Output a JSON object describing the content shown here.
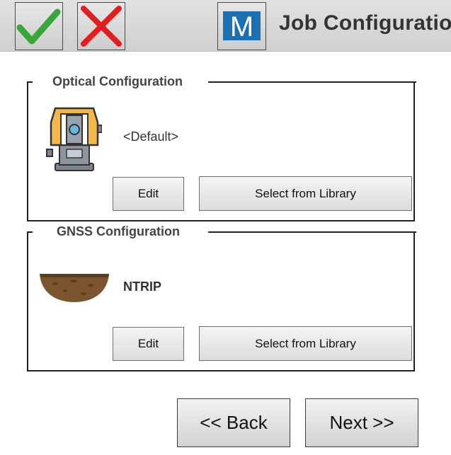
{
  "header": {
    "title": "Job Configuration",
    "ok_icon": "checkmark-icon",
    "cancel_icon": "close-icon",
    "logo_letter": "M",
    "colors": {
      "ok": "#3aa63a",
      "cancel": "#e02020",
      "logo": "#1c6fb0"
    }
  },
  "optical": {
    "title": "Optical Configuration",
    "value": "<Default>",
    "icon": "total-station-icon",
    "edit_label": "Edit",
    "library_label": "Select from Library"
  },
  "gnss": {
    "title": "GNSS Configuration",
    "value": "NTRIP",
    "icon": "ground-soil-icon",
    "edit_label": "Edit",
    "library_label": "Select from Library"
  },
  "nav": {
    "back_label": "<< Back",
    "next_label": "Next >>"
  }
}
